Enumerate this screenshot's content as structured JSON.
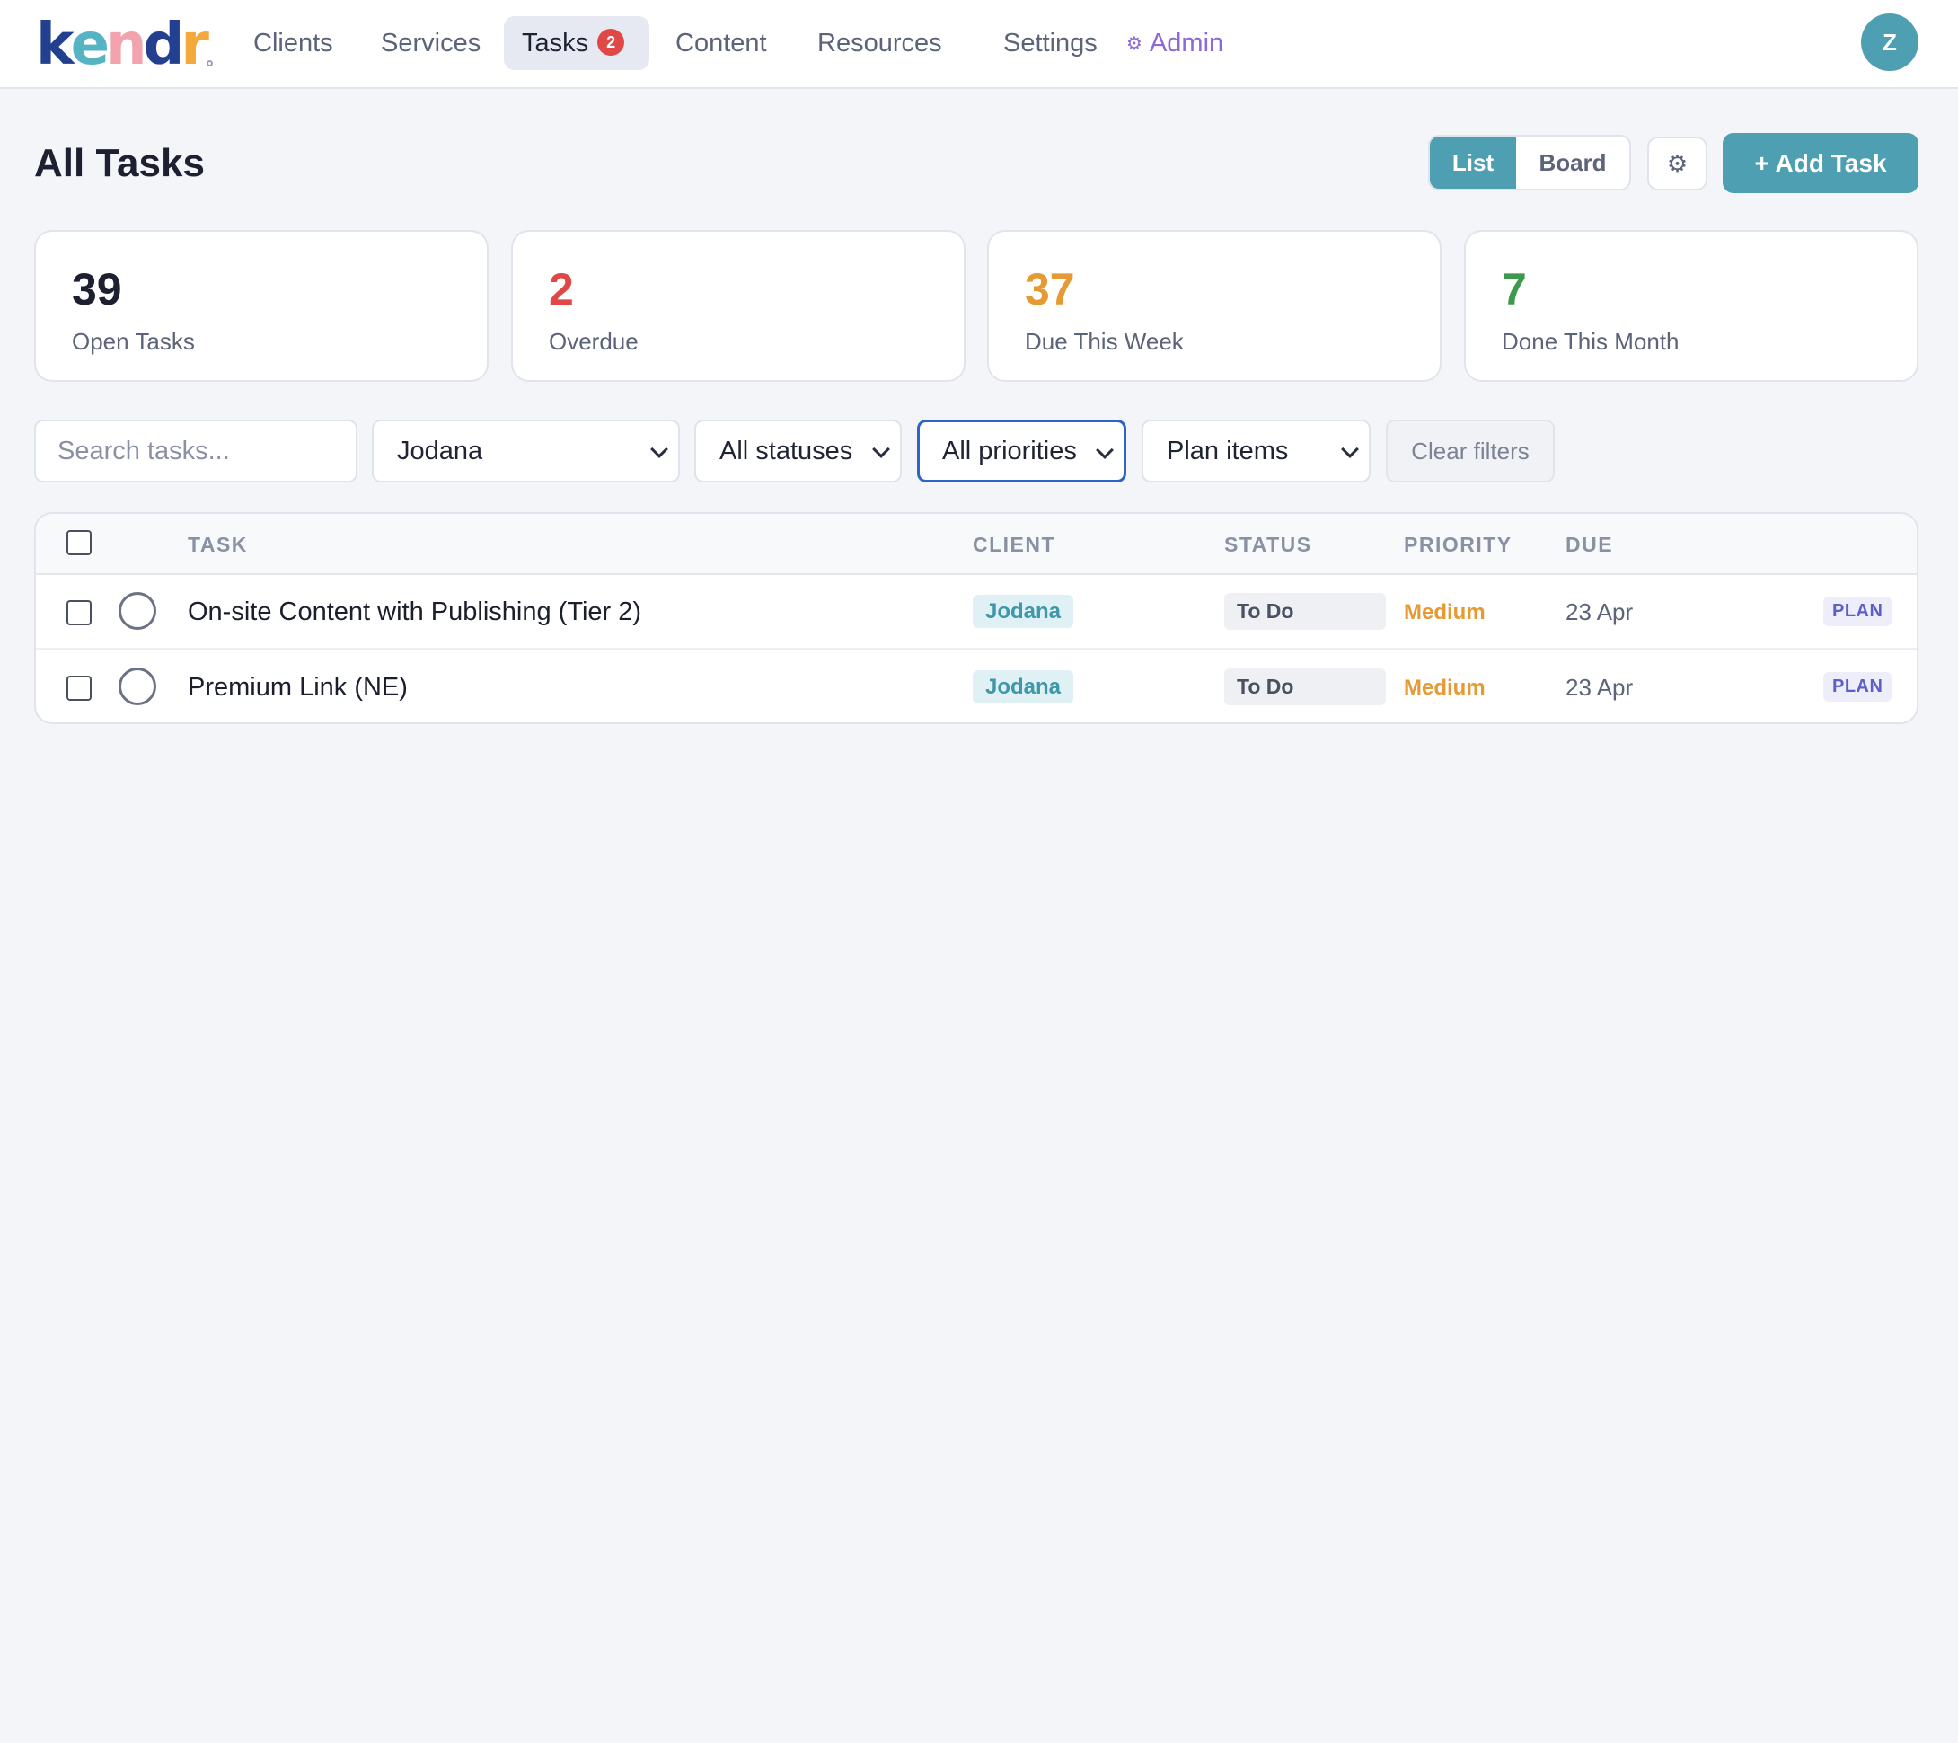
{
  "brand": {
    "logo_letters": [
      {
        "ch": "k",
        "color": "#233f8f"
      },
      {
        "ch": "e",
        "color": "#55b4c4"
      },
      {
        "ch": "n",
        "color": "#f2a3ae"
      },
      {
        "ch": "d",
        "color": "#233f8f"
      },
      {
        "ch": "r",
        "color": "#f3a93c"
      }
    ]
  },
  "nav": {
    "items": [
      {
        "label": "Clients"
      },
      {
        "label": "Services"
      },
      {
        "label": "Tasks",
        "badge": "2"
      },
      {
        "label": "Content"
      },
      {
        "label": "Resources"
      },
      {
        "label": "Settings"
      },
      {
        "label": "Admin"
      }
    ],
    "admin_icon": "⚙",
    "avatar_initial": "Z"
  },
  "page": {
    "title": "All Tasks",
    "view_list": "List",
    "view_board": "Board",
    "settings_icon": "⚙",
    "add_task": "+ Add Task"
  },
  "stats": [
    {
      "value": "39",
      "label": "Open Tasks",
      "color": "#1c2030"
    },
    {
      "value": "2",
      "label": "Overdue",
      "color": "#e04848"
    },
    {
      "value": "37",
      "label": "Due This Week",
      "color": "#e69a33"
    },
    {
      "value": "7",
      "label": "Done This Month",
      "color": "#3d9a4c"
    }
  ],
  "filters": {
    "search_placeholder": "Search tasks...",
    "client": "Jodana",
    "status": "All statuses",
    "priority": "All priorities",
    "type": "Plan items",
    "clear": "Clear filters"
  },
  "table": {
    "headers": {
      "task": "TASK",
      "client": "CLIENT",
      "status": "STATUS",
      "priority": "PRIORITY",
      "due": "DUE"
    },
    "rows": [
      {
        "task": "On-site Content with Publishing (Tier 2)",
        "client": "Jodana",
        "status": "To Do",
        "priority": "Medium",
        "due": "23 Apr",
        "tag": "PLAN"
      },
      {
        "task": "Premium Link (NE)",
        "client": "Jodana",
        "status": "To Do",
        "priority": "Medium",
        "due": "23 Apr",
        "tag": "PLAN"
      }
    ]
  }
}
